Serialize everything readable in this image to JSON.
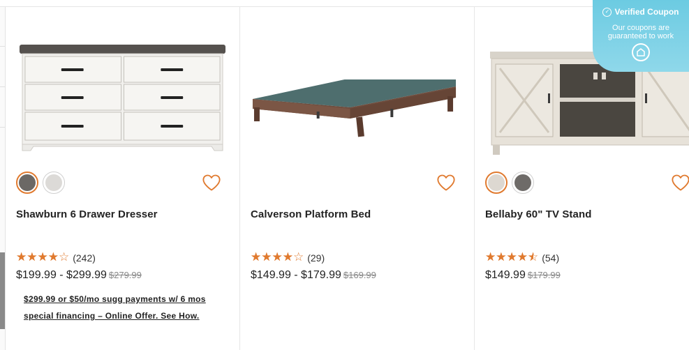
{
  "products": [
    {
      "name": "Shawburn 6 Drawer Dresser",
      "rating": 4.0,
      "review_count": "(242)",
      "price": "$199.99 - $299.99",
      "was_price": "$279.99",
      "swatches": [
        "#6b6865",
        "#dcdad7"
      ],
      "financing": "$299.99 or $50/mo sugg payments w/ 6 mos special financing – Online Offer. See How."
    },
    {
      "name": "Calverson Platform Bed",
      "rating": 4.0,
      "review_count": "(29)",
      "price": "$149.99 - $179.99",
      "was_price": "$169.99"
    },
    {
      "name": "Bellaby 60\" TV Stand",
      "rating": 4.5,
      "review_count": "(54)",
      "price": "$149.99",
      "was_price": "$179.99",
      "swatches": [
        "#ddd8d1",
        "#6e6b68"
      ]
    }
  ],
  "coupon": {
    "title": "Verified Coupon",
    "subtitle": "Our coupons are guaranteed to work"
  },
  "icons": {
    "heart": "heart-outline-icon",
    "star": "star-icon",
    "coupon_check": "check-circle-icon",
    "coupon_badge": "shield-home-icon"
  },
  "colors": {
    "accent": "#e07a2f",
    "coupon_bg": "#6ccbe2"
  }
}
